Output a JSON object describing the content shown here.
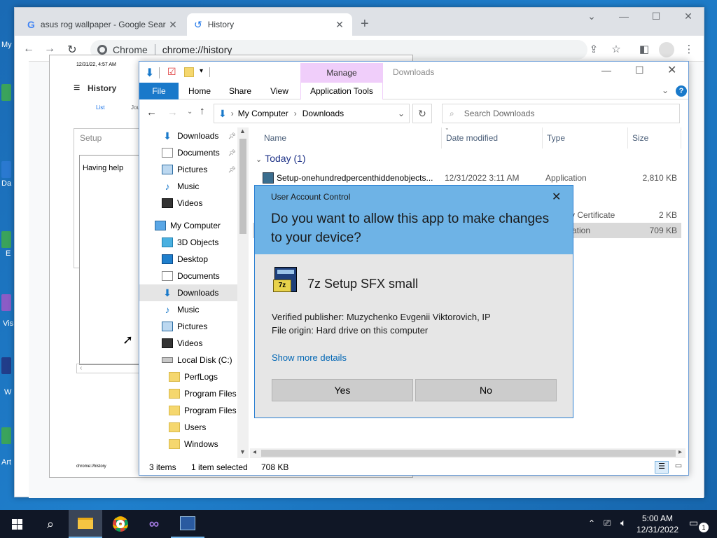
{
  "desktop": {
    "labels": [
      "My",
      "Da",
      "E",
      "Vis",
      "W",
      "Art"
    ]
  },
  "chrome": {
    "tabs": [
      {
        "title": "asus rog wallpaper - Google Sear",
        "icon": "google-g-icon"
      },
      {
        "title": "History",
        "icon": "history-icon"
      }
    ],
    "new_tab": "+",
    "omnibox": {
      "site": "Chrome",
      "url": "chrome://history"
    }
  },
  "history_print": {
    "date": "12/31/22, 4:57 AM",
    "title": "History",
    "list_tab": "List",
    "journeys_tab": "Jou",
    "setup_title": "Setup",
    "setup_text": "Having help",
    "footer": "chrome://history"
  },
  "explorer": {
    "title": "Downloads",
    "manage": "Manage",
    "ribbon_tabs": [
      "File",
      "Home",
      "Share",
      "View",
      "Application Tools"
    ],
    "breadcrumb": [
      "My Computer",
      "Downloads"
    ],
    "search_placeholder": "Search Downloads",
    "nav": [
      {
        "label": "Downloads",
        "icon": "download-arrow-icon",
        "pinned": true
      },
      {
        "label": "Documents",
        "icon": "document-icon",
        "pinned": true
      },
      {
        "label": "Pictures",
        "icon": "pictures-icon",
        "pinned": true
      },
      {
        "label": "Music",
        "icon": "music-note-icon",
        "pinned": false
      },
      {
        "label": "Videos",
        "icon": "film-icon",
        "pinned": false
      },
      {
        "label": "My Computer",
        "icon": "computer-icon",
        "pinned": false
      },
      {
        "label": "3D Objects",
        "icon": "cube-icon",
        "pinned": false
      },
      {
        "label": "Desktop",
        "icon": "desktop-icon",
        "pinned": false
      },
      {
        "label": "Documents",
        "icon": "document-icon",
        "pinned": false
      },
      {
        "label": "Downloads",
        "icon": "download-arrow-icon",
        "pinned": false,
        "selected": true
      },
      {
        "label": "Music",
        "icon": "music-note-icon",
        "pinned": false
      },
      {
        "label": "Pictures",
        "icon": "pictures-icon",
        "pinned": false
      },
      {
        "label": "Videos",
        "icon": "film-icon",
        "pinned": false
      },
      {
        "label": "Local Disk (C:)",
        "icon": "drive-icon",
        "pinned": false
      },
      {
        "label": "PerfLogs",
        "icon": "folder-icon",
        "pinned": false
      },
      {
        "label": "Program Files",
        "icon": "folder-icon",
        "pinned": false
      },
      {
        "label": "Program Files (",
        "icon": "folder-icon",
        "pinned": false
      },
      {
        "label": "Users",
        "icon": "folder-icon",
        "pinned": false
      },
      {
        "label": "Windows",
        "icon": "folder-icon",
        "pinned": false
      }
    ],
    "columns": [
      "Name",
      "Date modified",
      "Type",
      "Size"
    ],
    "group": "Today (1)",
    "files": [
      {
        "name": "Setup-onehundredpercenthiddenobjects...",
        "date": "12/31/2022 3:11 AM",
        "type": "Application",
        "size": "2,810 KB"
      },
      {
        "name": "",
        "date": "",
        "type": "y Certificate",
        "size": "2 KB"
      },
      {
        "name": "",
        "date": "",
        "type": "ation",
        "size": "709 KB"
      }
    ],
    "status": {
      "count": "3 items",
      "selected": "1 item selected",
      "size": "708 KB"
    }
  },
  "uac": {
    "header": "User Account Control",
    "question": "Do you want to allow this app to make changes to your device?",
    "app_name": "7z Setup SFX small",
    "publisher": "Verified publisher: Muzychenko Evgenii Viktorovich, IP",
    "origin": "File origin: Hard drive on this computer",
    "details_link": "Show more details",
    "yes": "Yes",
    "no": "No"
  },
  "taskbar": {
    "time": "5:00 AM",
    "date": "12/31/2022",
    "notifications": "1"
  },
  "colors": {
    "uac_header": "#6eb3e6",
    "uac_body": "#e6e6e6",
    "file_tab": "#1979ca",
    "manage": "#f0cefa",
    "taskbar": "#101726",
    "link": "#0066b4"
  }
}
